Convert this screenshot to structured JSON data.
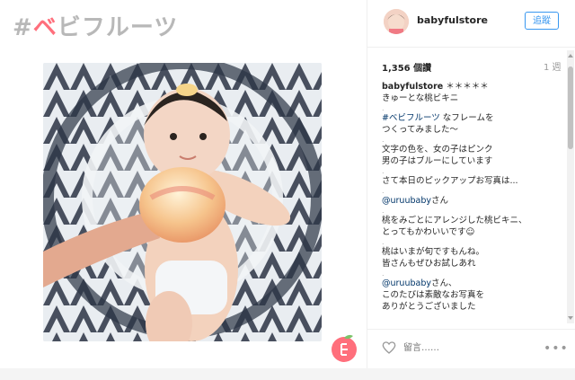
{
  "brand": {
    "hash": "#",
    "pink_part": "ベ",
    "rest": "ビフルーツ"
  },
  "colors": {
    "brand_gray": "#b8b8b8",
    "brand_pink": "#ff6f7c",
    "follow_blue": "#3897f0"
  },
  "post": {
    "username": "babyfulstore",
    "follow_label": "追蹤",
    "likes": "1,356 個讚",
    "comment_count": "1 週",
    "caption_lines": [
      {
        "type": "owner",
        "owner": "babyfulstore",
        "text": " ＊＊＊＊＊"
      },
      {
        "type": "text",
        "text": "きゅーとな桃ビキニ"
      },
      {
        "type": "spacer",
        "text": "."
      },
      {
        "type": "tag",
        "tag": "#ベビフルーツ",
        "text": " なフレームを"
      },
      {
        "type": "text",
        "text": "つくってみました〜"
      },
      {
        "type": "spacer",
        "text": "."
      },
      {
        "type": "text",
        "text": "文字の色を、女の子はピンク"
      },
      {
        "type": "text",
        "text": "男の子はブルーにしています"
      },
      {
        "type": "spacer",
        "text": "."
      },
      {
        "type": "text",
        "text": "さて本日のピックアップお写真は..."
      },
      {
        "type": "spacer",
        "text": "."
      },
      {
        "type": "tag",
        "tag": "@uruubaby",
        "text": "さん"
      },
      {
        "type": "spacer",
        "text": "."
      },
      {
        "type": "text",
        "text": "桃をみごとにアレンジした桃ビキニ、"
      },
      {
        "type": "text",
        "text": "とってもかわいいです☺"
      },
      {
        "type": "spacer",
        "text": "."
      },
      {
        "type": "text",
        "text": "桃はいまが旬ですもんね。"
      },
      {
        "type": "text",
        "text": "皆さんもぜひお試しあれ"
      },
      {
        "type": "spacer",
        "text": "."
      },
      {
        "type": "tag",
        "tag": "@uruubaby",
        "text": "さん、"
      },
      {
        "type": "text",
        "text": "このたびは素敵なお写真を"
      },
      {
        "type": "text",
        "text": "ありがとうございました"
      }
    ],
    "comment_placeholder": "留言……",
    "more_label": "•••"
  },
  "icons": {
    "heart": "heart-icon",
    "more": "more-options-icon",
    "logo": "peach-logo-icon"
  }
}
